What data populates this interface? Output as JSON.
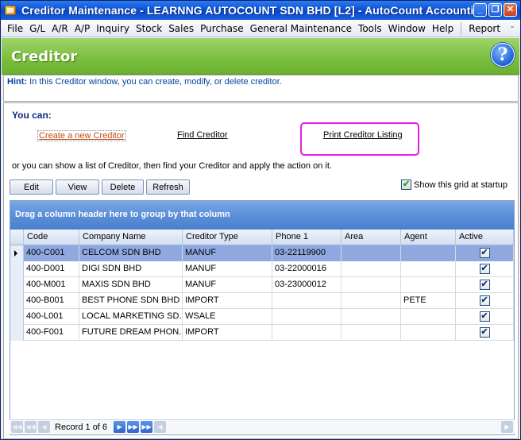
{
  "window": {
    "title": "Creditor Maintenance - LEARNNG AUTOCOUNT SDN BHD [L2] - AutoCount Accounting (Ver:...",
    "minimize": "_",
    "restore": "❐",
    "close": "✕"
  },
  "menu": {
    "items": [
      "File",
      "G/L",
      "A/R",
      "A/P",
      "Inquiry",
      "Stock",
      "Sales",
      "Purchase",
      "General Maintenance",
      "Tools",
      "Window",
      "Help"
    ],
    "report": "Report",
    "chevron": "⌄"
  },
  "header": {
    "title": "Creditor",
    "help_glyph": "?"
  },
  "hint": {
    "label": "Hint:",
    "text": "In this Creditor window, you can create, modify, or delete creditor."
  },
  "actions": {
    "you_can": "You can:",
    "create": "Create a new Creditor",
    "find": "Find Creditor",
    "print": "Print Creditor Listing",
    "or_text": "or you can show a list of Creditor, then find your Creditor and apply the action on it."
  },
  "buttons": {
    "edit": "Edit",
    "view": "View",
    "delete": "Delete",
    "refresh": "Refresh"
  },
  "show_grid": {
    "label": "Show this grid at startup",
    "checked": true
  },
  "grid": {
    "group_hint": "Drag a column header here to group by that column",
    "columns": [
      "Code",
      "Company Name",
      "Creditor Type",
      "Phone 1",
      "Area",
      "Agent",
      "Active"
    ],
    "rows": [
      {
        "code": "400-C001",
        "company": "CELCOM SDN BHD",
        "type": "MANUF",
        "phone": "03-22119900",
        "area": "",
        "agent": "",
        "active": true,
        "selected": true
      },
      {
        "code": "400-D001",
        "company": "DIGI SDN BHD",
        "type": "MANUF",
        "phone": "03-22000016",
        "area": "",
        "agent": "",
        "active": true,
        "selected": false
      },
      {
        "code": "400-M001",
        "company": "MAXIS SDN BHD",
        "type": "MANUF",
        "phone": "03-23000012",
        "area": "",
        "agent": "",
        "active": true,
        "selected": false
      },
      {
        "code": "400-B001",
        "company": "BEST PHONE SDN BHD",
        "type": "IMPORT",
        "phone": "",
        "area": "",
        "agent": "PETE",
        "active": true,
        "selected": false
      },
      {
        "code": "400-L001",
        "company": "LOCAL MARKETING SD...",
        "type": "WSALE",
        "phone": "",
        "area": "",
        "agent": "",
        "active": true,
        "selected": false
      },
      {
        "code": "400-F001",
        "company": "FUTURE DREAM PHON...",
        "type": "IMPORT",
        "phone": "",
        "area": "",
        "agent": "",
        "active": true,
        "selected": false
      }
    ]
  },
  "navigator": {
    "record_text": "Record 1 of 6"
  }
}
